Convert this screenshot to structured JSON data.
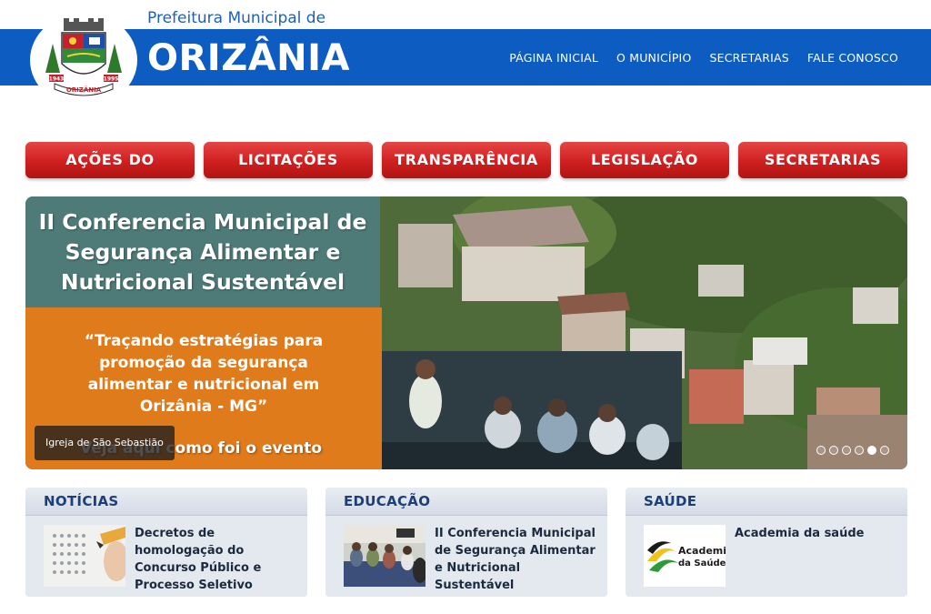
{
  "header": {
    "pre_title": "Prefeitura Municipal de",
    "title": "ORIZÂNIA",
    "crest_left_year": "1943",
    "crest_right_year": "1995",
    "crest_ribbon": "ORIZÂNIA",
    "nav": [
      {
        "label": "PÁGINA INICIAL"
      },
      {
        "label": "O MUNICÍPIO"
      },
      {
        "label": "SECRETARIAS"
      },
      {
        "label": "FALE CONOSCO"
      }
    ]
  },
  "quick_links": [
    {
      "label": "AÇÕES DO GOVERNO"
    },
    {
      "label": "LICITAÇÕES"
    },
    {
      "label": "TRANSPARÊNCIA"
    },
    {
      "label": "LEGISLAÇÃO"
    },
    {
      "label": "SECRETARIAS"
    }
  ],
  "slider": {
    "title_line1": "II Conferencia Municipal de",
    "title_line2": "Segurança Alimentar e",
    "title_line3": "Nutricional Sustentável",
    "quote_line1": "“Traçando estratégias para",
    "quote_line2": "promoção da segurança",
    "quote_line3": "alimentar e nutricional em",
    "quote_line4": "Orizânia - MG”",
    "link_text": "Veja aqui como foi o evento",
    "caption": "Igreja de São Sebastião",
    "slide_count": 6,
    "active_slide": 5
  },
  "boxes": {
    "news": {
      "heading": "NOTÍCIAS",
      "item_text": "Decretos de homologação do Concurso Público e Processo Seletivo",
      "thumb_icon": "exam-answer-sheet-icon"
    },
    "education": {
      "heading": "EDUCAÇÃO",
      "item_text": "II Conferencia Municipal de Segurança Alimentar e Nutricional Sustentável",
      "thumb_icon": "meeting-photo-icon"
    },
    "health": {
      "heading": "SAÚDE",
      "item_text": "Academia da saúde",
      "logo_line1": "Academia",
      "logo_line2": "da Saúde"
    }
  },
  "colors": {
    "header_blue": "#0c5cc2",
    "button_red": "#cf1f1f",
    "box_heading": "#1c3f78",
    "orange": "#e07b1c"
  }
}
